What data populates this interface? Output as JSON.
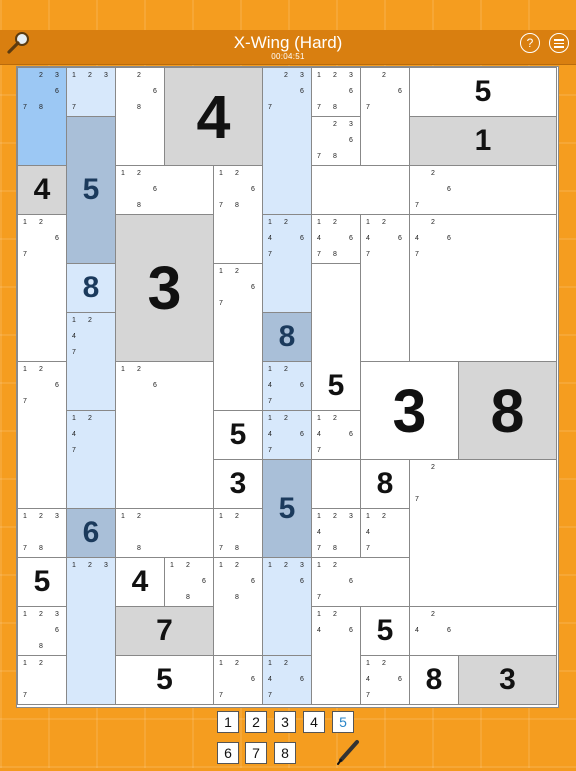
{
  "header": {
    "title": "X-Wing (Hard)",
    "timer": "00:04:51",
    "help_glyph": "?"
  },
  "colors": {
    "header_bg": "#d97f10",
    "background": "#f59d1f",
    "cell_white": "#ffffff",
    "cell_gray": "#d6d6d6",
    "highlight_light_blue": "#d7e8fb",
    "highlight_blue": "#9cc8f4",
    "highlight_dark_blue": "#a9bfd8",
    "given_blue_dark": "#1b3a5c",
    "selected_digit": "#2a86c8"
  },
  "icons": [
    "magnifier-icon",
    "help-icon",
    "menu-icon",
    "pencil-icon"
  ],
  "board": {
    "cells": [
      {
        "id": "r0c0",
        "v": "",
        "bg": "#9cc8f4",
        "cands": [
          "2",
          "3",
          "6",
          "7",
          "8"
        ]
      },
      {
        "id": "r0c1",
        "v": "",
        "bg": "#d7e8fb",
        "cands": [
          "1",
          "2",
          "3",
          "7"
        ]
      },
      {
        "id": "r0c2",
        "v": "",
        "bg": "#ffffff",
        "cands": [
          "2",
          "6",
          "8"
        ]
      },
      {
        "id": "r0c3",
        "v": "4",
        "bg": "#d6d6d6"
      },
      {
        "id": "r0c5",
        "v": "",
        "bg": "#d7e8fb",
        "cands": [
          "2",
          "3",
          "6",
          "7"
        ]
      },
      {
        "id": "r0c6",
        "v": "",
        "bg": "#ffffff",
        "cands": [
          "1",
          "2",
          "3",
          "6",
          "7",
          "8"
        ]
      },
      {
        "id": "r0c7",
        "v": "",
        "bg": "#ffffff",
        "cands": [
          "2",
          "6",
          "7"
        ]
      },
      {
        "id": "r0c8",
        "v": "5",
        "bg": "#ffffff"
      },
      {
        "id": "r1c6",
        "v": "",
        "bg": "#ffffff",
        "cands": [
          "2",
          "3",
          "6",
          "7",
          "8"
        ]
      },
      {
        "id": "r1c8",
        "v": "1",
        "bg": "#d6d6d6"
      },
      {
        "id": "r2c0",
        "v": "4",
        "bg": "#d6d6d6"
      },
      {
        "id": "r1c1",
        "v": "5",
        "bg": "#a9bfd8",
        "dark": true
      },
      {
        "id": "r2c2",
        "v": "",
        "bg": "#ffffff",
        "cands": [
          "1",
          "2",
          "6",
          "8"
        ]
      },
      {
        "id": "r2c4",
        "v": "",
        "bg": "#ffffff",
        "cands": [
          "1",
          "2",
          "6",
          "7",
          "8"
        ]
      },
      {
        "id": "r2c7",
        "v": "",
        "bg": "#ffffff",
        "cands": [
          "2",
          "6",
          "7"
        ]
      },
      {
        "id": "r3c0",
        "v": "",
        "bg": "#ffffff",
        "cands": [
          "1",
          "2",
          "6",
          "7"
        ]
      },
      {
        "id": "r3c1",
        "v": "8",
        "bg": "#d7e8fb",
        "dark": true
      },
      {
        "id": "r3c2",
        "v": "3",
        "bg": "#d6d6d6"
      },
      {
        "id": "r3c5",
        "v": "",
        "bg": "#d7e8fb",
        "cands": [
          "1",
          "2",
          "4",
          "6",
          "7"
        ]
      },
      {
        "id": "r3c6",
        "v": "",
        "bg": "#ffffff",
        "cands": [
          "1",
          "2",
          "4",
          "6",
          "7",
          "8"
        ]
      },
      {
        "id": "r3c7",
        "v": "",
        "bg": "#ffffff",
        "cands": [
          "1",
          "2",
          "4",
          "6",
          "7"
        ]
      },
      {
        "id": "r3c8",
        "v": "",
        "bg": "#ffffff",
        "cands": [
          "2",
          "4",
          "6",
          "7"
        ]
      },
      {
        "id": "r4c1",
        "v": "",
        "bg": "#d7e8fb",
        "cands": [
          "1",
          "2",
          "4",
          "7"
        ]
      },
      {
        "id": "r4c4",
        "v": "",
        "bg": "#ffffff",
        "cands": [
          "1",
          "2",
          "6",
          "7"
        ]
      },
      {
        "id": "r5c5",
        "v": "8",
        "bg": "#a9bfd8",
        "dark": true
      },
      {
        "id": "r4c6",
        "v": "5",
        "bg": "#ffffff"
      },
      {
        "id": "r6c0",
        "v": "",
        "bg": "#ffffff",
        "cands": [
          "1",
          "2",
          "6",
          "7"
        ]
      },
      {
        "id": "r6c2",
        "v": "",
        "bg": "#ffffff",
        "cands": [
          "1",
          "2",
          "6"
        ]
      },
      {
        "id": "r6c5",
        "v": "",
        "bg": "#d7e8fb",
        "cands": [
          "1",
          "2",
          "4",
          "6",
          "7"
        ]
      },
      {
        "id": "r6c7",
        "v": "3",
        "bg": "#ffffff"
      },
      {
        "id": "r6c8",
        "v": "8",
        "bg": "#d6d6d6"
      },
      {
        "id": "r7c1",
        "v": "",
        "bg": "#d7e8fb",
        "cands": [
          "1",
          "2",
          "4",
          "7"
        ]
      },
      {
        "id": "r7c4",
        "v": "5",
        "bg": "#ffffff"
      },
      {
        "id": "r7c5",
        "v": "",
        "bg": "#d7e8fb",
        "cands": [
          "1",
          "2",
          "4",
          "6",
          "7"
        ]
      },
      {
        "id": "r7c6",
        "v": "",
        "bg": "#ffffff",
        "cands": [
          "1",
          "2",
          "4",
          "6",
          "7"
        ]
      },
      {
        "id": "r8c4",
        "v": "3",
        "bg": "#ffffff"
      },
      {
        "id": "r8c5",
        "v": "5",
        "bg": "#a9bfd8",
        "dark": true
      },
      {
        "id": "r8c7",
        "v": "8",
        "bg": "#ffffff"
      },
      {
        "id": "r8c8",
        "v": "",
        "bg": "#ffffff",
        "cands": [
          "2",
          "7"
        ]
      },
      {
        "id": "r9c0",
        "v": "",
        "bg": "#ffffff",
        "cands": [
          "1",
          "2",
          "3",
          "7",
          "8"
        ]
      },
      {
        "id": "r9c1",
        "v": "6",
        "bg": "#a9bfd8",
        "dark": true
      },
      {
        "id": "r9c2",
        "v": "",
        "bg": "#ffffff",
        "cands": [
          "1",
          "2",
          "8"
        ]
      },
      {
        "id": "r9c4",
        "v": "",
        "bg": "#ffffff",
        "cands": [
          "1",
          "2",
          "7",
          "8"
        ]
      },
      {
        "id": "r9c6",
        "v": "",
        "bg": "#ffffff",
        "cands": [
          "1",
          "2",
          "3",
          "4",
          "7",
          "8"
        ]
      },
      {
        "id": "r9c7",
        "v": "",
        "bg": "#ffffff",
        "cands": [
          "1",
          "2",
          "4",
          "7"
        ]
      },
      {
        "id": "r10c0",
        "v": "5",
        "bg": "#ffffff"
      },
      {
        "id": "r10c1",
        "v": "",
        "bg": "#d7e8fb",
        "cands": [
          "1",
          "2",
          "3"
        ]
      },
      {
        "id": "r10c2",
        "v": "4",
        "bg": "#ffffff"
      },
      {
        "id": "r10c3",
        "v": "",
        "bg": "#ffffff",
        "cands": [
          "1",
          "2",
          "6",
          "8"
        ]
      },
      {
        "id": "r10c4",
        "v": "",
        "bg": "#ffffff",
        "cands": [
          "1",
          "2",
          "6",
          "8"
        ]
      },
      {
        "id": "r10c5",
        "v": "",
        "bg": "#d7e8fb",
        "cands": [
          "1",
          "2",
          "3",
          "6"
        ]
      },
      {
        "id": "r10c6",
        "v": "",
        "bg": "#ffffff",
        "cands": [
          "1",
          "2",
          "6",
          "7"
        ]
      },
      {
        "id": "r11c0",
        "v": "",
        "bg": "#ffffff",
        "cands": [
          "1",
          "2",
          "3",
          "6",
          "8"
        ]
      },
      {
        "id": "r11c2",
        "v": "7",
        "bg": "#d6d6d6"
      },
      {
        "id": "r11c6",
        "v": "",
        "bg": "#ffffff",
        "cands": [
          "1",
          "2",
          "4",
          "6"
        ]
      },
      {
        "id": "r11c7",
        "v": "5",
        "bg": "#ffffff"
      },
      {
        "id": "r11c8",
        "v": "",
        "bg": "#ffffff",
        "cands": [
          "2",
          "4",
          "6"
        ]
      },
      {
        "id": "r12c0",
        "v": "",
        "bg": "#ffffff",
        "cands": [
          "1",
          "2",
          "7"
        ]
      },
      {
        "id": "r12c2",
        "v": "5",
        "bg": "#ffffff"
      },
      {
        "id": "r12c4",
        "v": "",
        "bg": "#ffffff",
        "cands": [
          "1",
          "2",
          "6",
          "7"
        ]
      },
      {
        "id": "r12c5",
        "v": "",
        "bg": "#d7e8fb",
        "cands": [
          "1",
          "2",
          "4",
          "6",
          "7"
        ]
      },
      {
        "id": "r12c7",
        "v": "",
        "bg": "#ffffff",
        "cands": [
          "1",
          "2",
          "4",
          "6",
          "7"
        ]
      },
      {
        "id": "r12c8a",
        "v": "8",
        "bg": "#ffffff"
      },
      {
        "id": "r12c8b",
        "v": "3",
        "bg": "#d6d6d6"
      }
    ]
  },
  "numpad": {
    "keys": [
      "1",
      "2",
      "3",
      "4",
      "5",
      "6",
      "7",
      "8"
    ],
    "selected": "5"
  }
}
